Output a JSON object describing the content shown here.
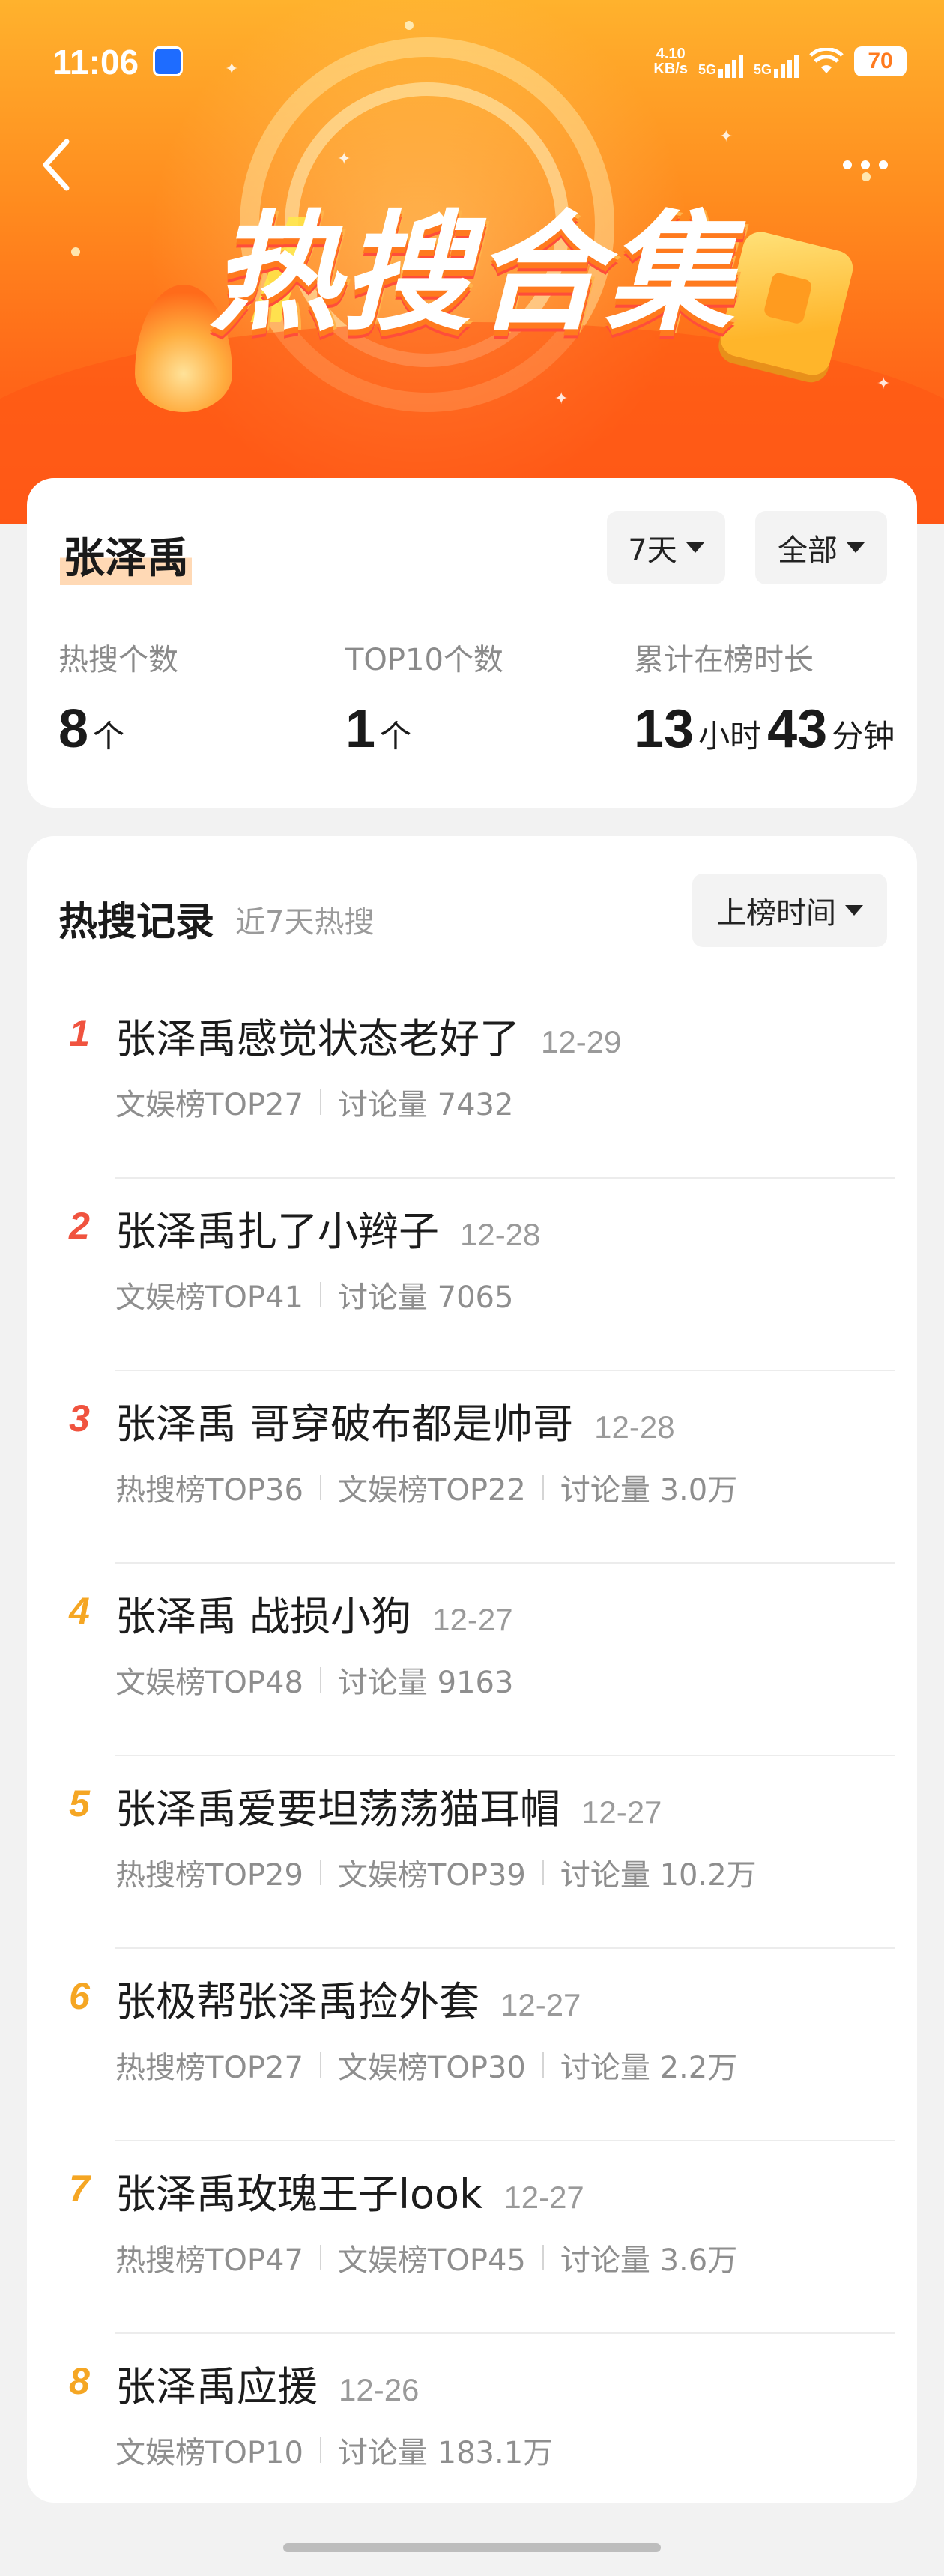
{
  "status_bar": {
    "time": "11:06",
    "net_speed_value": "4.10",
    "net_speed_unit": "KB/s",
    "signal1_label": "5G",
    "signal2_label": "5G",
    "battery": "70"
  },
  "header": {
    "banner_title": "热搜合集",
    "back_icon": "chevron-left-icon",
    "more_icon": "more-dots-icon"
  },
  "summary": {
    "name": "张泽禹",
    "filter_days": "7天",
    "filter_category": "全部",
    "stats": [
      {
        "label": "热搜个数",
        "parts": [
          {
            "num": "8",
            "unit": "个"
          }
        ]
      },
      {
        "label": "TOP10个数",
        "parts": [
          {
            "num": "1",
            "unit": "个"
          }
        ]
      },
      {
        "label": "累计在榜时长",
        "parts": [
          {
            "num": "13",
            "unit": "小时"
          },
          {
            "num": "43",
            "unit": "分钟"
          }
        ]
      }
    ]
  },
  "records": {
    "title": "热搜记录",
    "subtitle": "近7天热搜",
    "sort_label": "上榜时间",
    "rank_colors": {
      "top3": "#f0533f",
      "rest": "#f5a623"
    },
    "items": [
      {
        "rank": "1",
        "title": "张泽禹感觉状态老好了",
        "date": "12-29",
        "meta": [
          "文娱榜TOP27",
          "讨论量 7432"
        ]
      },
      {
        "rank": "2",
        "title": "张泽禹扎了小辫子",
        "date": "12-28",
        "meta": [
          "文娱榜TOP41",
          "讨论量 7065"
        ]
      },
      {
        "rank": "3",
        "title": "张泽禹 哥穿破布都是帅哥",
        "date": "12-28",
        "meta": [
          "热搜榜TOP36",
          "文娱榜TOP22",
          "讨论量 3.0万"
        ]
      },
      {
        "rank": "4",
        "title": "张泽禹 战损小狗",
        "date": "12-27",
        "meta": [
          "文娱榜TOP48",
          "讨论量 9163"
        ]
      },
      {
        "rank": "5",
        "title": "张泽禹爱要坦荡荡猫耳帽",
        "date": "12-27",
        "meta": [
          "热搜榜TOP29",
          "文娱榜TOP39",
          "讨论量 10.2万"
        ]
      },
      {
        "rank": "6",
        "title": "张极帮张泽禹捡外套",
        "date": "12-27",
        "meta": [
          "热搜榜TOP27",
          "文娱榜TOP30",
          "讨论量 2.2万"
        ]
      },
      {
        "rank": "7",
        "title": "张泽禹玫瑰王子look",
        "date": "12-27",
        "meta": [
          "热搜榜TOP47",
          "文娱榜TOP45",
          "讨论量 3.6万"
        ]
      },
      {
        "rank": "8",
        "title": "张泽禹应援",
        "date": "12-26",
        "meta": [
          "文娱榜TOP10",
          "讨论量 183.1万"
        ]
      }
    ]
  }
}
